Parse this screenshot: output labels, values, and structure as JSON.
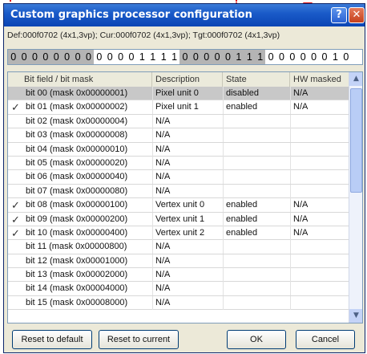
{
  "window": {
    "title": "Custom graphics processor configuration",
    "help_glyph": "?",
    "close_glyph": "✕"
  },
  "info_line": "Def:000f0702 (4x1,3vp); Cur:000f0702 (4x1,3vp); Tgt:000f0702 (4x1,3vp)",
  "bits": [
    {
      "v": "0",
      "hl": true
    },
    {
      "v": "0",
      "hl": true
    },
    {
      "v": "0",
      "hl": true
    },
    {
      "v": "0",
      "hl": true
    },
    {
      "v": "0",
      "hl": true
    },
    {
      "v": "0",
      "hl": true
    },
    {
      "v": "0",
      "hl": true
    },
    {
      "v": "0",
      "hl": true
    },
    {
      "v": "0",
      "hl": false
    },
    {
      "v": "0",
      "hl": false
    },
    {
      "v": "0",
      "hl": false
    },
    {
      "v": "0",
      "hl": false
    },
    {
      "v": "1",
      "hl": false
    },
    {
      "v": "1",
      "hl": false
    },
    {
      "v": "1",
      "hl": false
    },
    {
      "v": "1",
      "hl": false
    },
    {
      "v": "0",
      "hl": true
    },
    {
      "v": "0",
      "hl": true
    },
    {
      "v": "0",
      "hl": true
    },
    {
      "v": "0",
      "hl": true
    },
    {
      "v": "0",
      "hl": true
    },
    {
      "v": "1",
      "hl": true
    },
    {
      "v": "1",
      "hl": true
    },
    {
      "v": "1",
      "hl": true
    },
    {
      "v": "0",
      "hl": false
    },
    {
      "v": "0",
      "hl": false
    },
    {
      "v": "0",
      "hl": false
    },
    {
      "v": "0",
      "hl": false
    },
    {
      "v": "0",
      "hl": false
    },
    {
      "v": "0",
      "hl": false
    },
    {
      "v": "1",
      "hl": false
    },
    {
      "v": "0",
      "hl": false
    }
  ],
  "table": {
    "columns": [
      "Bit field / bit mask",
      "Description",
      "State",
      "HW masked"
    ],
    "rows": [
      {
        "field": "bit 00 (mask 0x00000001)",
        "desc": "Pixel unit 0",
        "state": "disabled",
        "hw": "N/A",
        "checked": false,
        "selected": true
      },
      {
        "field": "bit 01 (mask 0x00000002)",
        "desc": "Pixel unit 1",
        "state": "enabled",
        "hw": "N/A",
        "checked": true,
        "selected": false
      },
      {
        "field": "bit 02 (mask 0x00000004)",
        "desc": "N/A",
        "state": "",
        "hw": "",
        "checked": false,
        "selected": false
      },
      {
        "field": "bit 03 (mask 0x00000008)",
        "desc": "N/A",
        "state": "",
        "hw": "",
        "checked": false,
        "selected": false
      },
      {
        "field": "bit 04 (mask 0x00000010)",
        "desc": "N/A",
        "state": "",
        "hw": "",
        "checked": false,
        "selected": false
      },
      {
        "field": "bit 05 (mask 0x00000020)",
        "desc": "N/A",
        "state": "",
        "hw": "",
        "checked": false,
        "selected": false
      },
      {
        "field": "bit 06 (mask 0x00000040)",
        "desc": "N/A",
        "state": "",
        "hw": "",
        "checked": false,
        "selected": false
      },
      {
        "field": "bit 07 (mask 0x00000080)",
        "desc": "N/A",
        "state": "",
        "hw": "",
        "checked": false,
        "selected": false
      },
      {
        "field": "bit 08 (mask 0x00000100)",
        "desc": "Vertex unit 0",
        "state": "enabled",
        "hw": "N/A",
        "checked": true,
        "selected": false
      },
      {
        "field": "bit 09 (mask 0x00000200)",
        "desc": "Vertex unit 1",
        "state": "enabled",
        "hw": "N/A",
        "checked": true,
        "selected": false
      },
      {
        "field": "bit 10 (mask 0x00000400)",
        "desc": "Vertex unit 2",
        "state": "enabled",
        "hw": "N/A",
        "checked": true,
        "selected": false
      },
      {
        "field": "bit 11 (mask 0x00000800)",
        "desc": "N/A",
        "state": "",
        "hw": "",
        "checked": false,
        "selected": false
      },
      {
        "field": "bit 12 (mask 0x00001000)",
        "desc": "N/A",
        "state": "",
        "hw": "",
        "checked": false,
        "selected": false
      },
      {
        "field": "bit 13 (mask 0x00002000)",
        "desc": "N/A",
        "state": "",
        "hw": "",
        "checked": false,
        "selected": false
      },
      {
        "field": "bit 14 (mask 0x00004000)",
        "desc": "N/A",
        "state": "",
        "hw": "",
        "checked": false,
        "selected": false
      },
      {
        "field": "bit 15 (mask 0x00008000)",
        "desc": "N/A",
        "state": "",
        "hw": "",
        "checked": false,
        "selected": false
      }
    ]
  },
  "buttons": {
    "reset_default": "Reset to default",
    "reset_current": "Reset to current",
    "ok": "OK",
    "cancel": "Cancel"
  },
  "colors": {
    "marker": "#e01010",
    "titlebar": "#0b45b4"
  }
}
